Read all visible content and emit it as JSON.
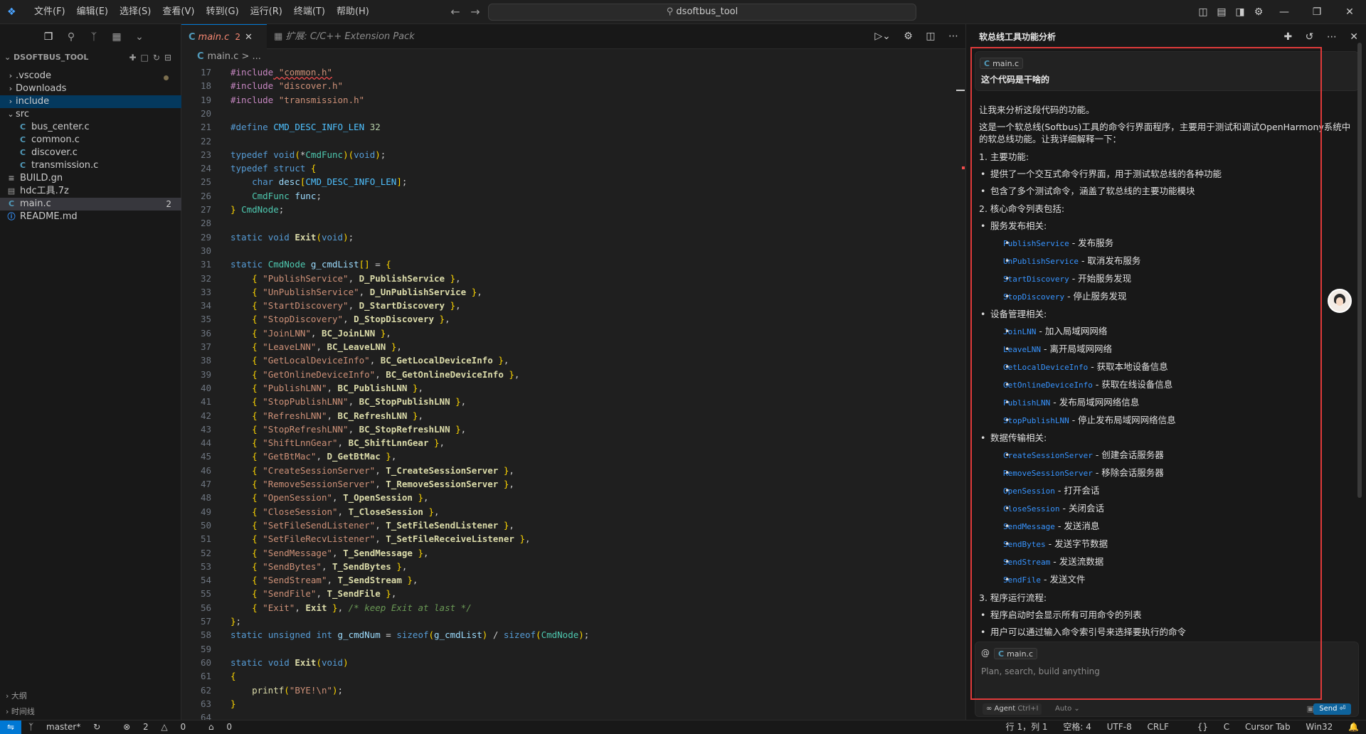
{
  "titlebar": {
    "menus": [
      "文件(F)",
      "编辑(E)",
      "选择(S)",
      "查看(V)",
      "转到(G)",
      "运行(R)",
      "终端(T)",
      "帮助(H)"
    ],
    "search": "dsoftbus_tool"
  },
  "explorer": {
    "title": "DSOFTBUS_TOOL",
    "items": [
      {
        "label": ".vscode",
        "type": "folder",
        "open": false,
        "indent": 0
      },
      {
        "label": "Downloads",
        "type": "folder",
        "open": false,
        "indent": 0
      },
      {
        "label": "include",
        "type": "folder",
        "open": false,
        "indent": 0
      },
      {
        "label": "src",
        "type": "folder",
        "open": true,
        "indent": 0
      },
      {
        "label": "bus_center.c",
        "type": "c",
        "indent": 1
      },
      {
        "label": "common.c",
        "type": "c",
        "indent": 1
      },
      {
        "label": "discover.c",
        "type": "c",
        "indent": 1
      },
      {
        "label": "transmission.c",
        "type": "c",
        "indent": 1
      },
      {
        "label": "BUILD.gn",
        "type": "gn",
        "indent": 0
      },
      {
        "label": "hdc工具.7z",
        "type": "zip",
        "indent": 0
      },
      {
        "label": "main.c",
        "type": "c",
        "indent": 0,
        "badge": "2"
      },
      {
        "label": "README.md",
        "type": "info",
        "indent": 0
      }
    ],
    "outline": "大纲",
    "timeline": "时间线"
  },
  "editor": {
    "tab_active": "main.c",
    "tab_active_problems": "2",
    "tab_ext": "扩展: C/C++ Extension Pack",
    "breadcrumb": "main.c > ...",
    "line_numbers": [
      "17",
      "18",
      "19",
      "20",
      "21",
      "22",
      "23",
      "24",
      "25",
      "26",
      "27",
      "28",
      "29",
      "30",
      "31",
      "32",
      "33",
      "34",
      "35",
      "36",
      "37",
      "38",
      "39",
      "40",
      "41",
      "42",
      "43",
      "44",
      "45",
      "46",
      "47",
      "48",
      "49",
      "50",
      "51",
      "52",
      "53",
      "54",
      "55",
      "56",
      "57",
      "58",
      "59",
      "60",
      "61",
      "62",
      "63",
      "64"
    ],
    "code_lines": [
      "#include \"common.h\"",
      "#include \"discover.h\"",
      "#include \"transmission.h\"",
      "",
      "#define CMD_DESC_INFO_LEN 32",
      "",
      "typedef void(*CmdFunc)(void);",
      "typedef struct {",
      "    char desc[CMD_DESC_INFO_LEN];",
      "    CmdFunc func;",
      "} CmdNode;",
      "",
      "static void Exit(void);",
      "",
      "static CmdNode g_cmdList[] = {",
      "    { \"PublishService\", D_PublishService },",
      "    { \"UnPublishService\", D_UnPublishService },",
      "    { \"StartDiscovery\", D_StartDiscovery },",
      "    { \"StopDiscovery\", D_StopDiscovery },",
      "    { \"JoinLNN\", BC_JoinLNN },",
      "    { \"LeaveLNN\", BC_LeaveLNN },",
      "    { \"GetLocalDeviceInfo\", BC_GetLocalDeviceInfo },",
      "    { \"GetOnlineDeviceInfo\", BC_GetOnlineDeviceInfo },",
      "    { \"PublishLNN\", BC_PublishLNN },",
      "    { \"StopPublishLNN\", BC_StopPublishLNN },",
      "    { \"RefreshLNN\", BC_RefreshLNN },",
      "    { \"StopRefreshLNN\", BC_StopRefreshLNN },",
      "    { \"ShiftLnnGear\", BC_ShiftLnnGear },",
      "    { \"GetBtMac\", D_GetBtMac },",
      "    { \"CreateSessionServer\", T_CreateSessionServer },",
      "    { \"RemoveSessionServer\", T_RemoveSessionServer },",
      "    { \"OpenSession\", T_OpenSession },",
      "    { \"CloseSession\", T_CloseSession },",
      "    { \"SetFileSendListener\", T_SetFileSendListener },",
      "    { \"SetFileRecvListener\", T_SetFileReceiveListener },",
      "    { \"SendMessage\", T_SendMessage },",
      "    { \"SendBytes\", T_SendBytes },",
      "    { \"SendStream\", T_SendStream },",
      "    { \"SendFile\", T_SendFile },",
      "    { \"Exit\", Exit }, /* keep Exit at last */",
      "};",
      "static unsigned int g_cmdNum = sizeof(g_cmdList) / sizeof(CmdNode);",
      "",
      "static void Exit(void)",
      "{",
      "    printf(\"BYE!\\n\");",
      "}",
      ""
    ]
  },
  "chat": {
    "title": "软总线工具功能分析",
    "query_file": "main.c",
    "query": "这个代码是干啥的",
    "intro1": "让我来分析这段代码的功能。",
    "intro2": "这是一个软总线(Softbus)工具的命令行界面程序，主要用于测试和调试OpenHarmony系统中的软总线功能。让我详细解释一下：",
    "sec1": "1. 主要功能:",
    "sec1_items": [
      "提供了一个交互式命令行界面，用于测试软总线的各种功能",
      "包含了多个测试命令，涵盖了软总线的主要功能模块"
    ],
    "sec2": "2. 核心命令列表包括:",
    "groups": [
      {
        "title": "服务发布相关:",
        "items": [
          {
            "code": "PublishService",
            "desc": " - 发布服务"
          },
          {
            "code": "UnPublishService",
            "desc": " - 取消发布服务"
          },
          {
            "code": "StartDiscovery",
            "desc": " - 开始服务发现"
          },
          {
            "code": "StopDiscovery",
            "desc": " - 停止服务发现"
          }
        ]
      },
      {
        "title": "设备管理相关:",
        "items": [
          {
            "code": "JoinLNN",
            "desc": " - 加入局域网网络"
          },
          {
            "code": "LeaveLNN",
            "desc": " - 离开局域网网络"
          },
          {
            "code": "GetLocalDeviceInfo",
            "desc": " - 获取本地设备信息"
          },
          {
            "code": "GetOnlineDeviceInfo",
            "desc": " - 获取在线设备信息"
          },
          {
            "code": "PublishLNN",
            "desc": " - 发布局域网网络信息"
          },
          {
            "code": "StopPublishLNN",
            "desc": " - 停止发布局域网网络信息"
          }
        ]
      },
      {
        "title": "数据传输相关:",
        "items": [
          {
            "code": "CreateSessionServer",
            "desc": " - 创建会话服务器"
          },
          {
            "code": "RemoveSessionServer",
            "desc": " - 移除会话服务器"
          },
          {
            "code": "OpenSession",
            "desc": " - 打开会话"
          },
          {
            "code": "CloseSession",
            "desc": " - 关闭会话"
          },
          {
            "code": "SendMessage",
            "desc": " - 发送消息"
          },
          {
            "code": "SendBytes",
            "desc": " - 发送字节数据"
          },
          {
            "code": "SendStream",
            "desc": " - 发送流数据"
          },
          {
            "code": "SendFile",
            "desc": " - 发送文件"
          }
        ]
      }
    ],
    "sec3": "3. 程序运行流程:",
    "sec3_items": [
      "程序启动时会显示所有可用命令的列表",
      "用户可以通过输入命令索引号来选择要执行的命令"
    ],
    "input_file": "main.c",
    "input_placeholder": "Plan, search, build anything",
    "agent_label": "Agent",
    "agent_shortcut": "Ctrl+I",
    "auto_label": "Auto",
    "send_label": "Send"
  },
  "statusbar": {
    "branch": "master*",
    "errors": "2",
    "warnings": "0",
    "ports": "0",
    "position": "行 1，列 1",
    "spaces": "空格: 4",
    "encoding": "UTF-8",
    "eol": "CRLF",
    "language": "C",
    "tab_mode": "Cursor Tab",
    "platform": "Win32"
  },
  "colors": {
    "accent": "#0078d4",
    "highlight_border": "#e03a3a",
    "code_keyword": "#569cd6",
    "code_string": "#ce9178"
  }
}
